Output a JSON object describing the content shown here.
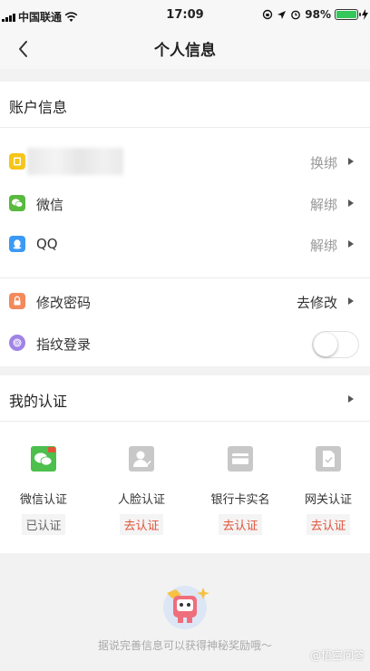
{
  "status_bar": {
    "carrier": "中国联通",
    "time": "17:09",
    "battery_pct": "98%",
    "battery_level": 0.98,
    "icons": [
      "signal-bars-icon",
      "wifi-icon",
      "rotation-lock-icon",
      "location-icon",
      "alarm-icon",
      "battery-icon",
      "charging-icon"
    ]
  },
  "nav": {
    "title": "个人信息",
    "back_icon": "chevron-left-icon"
  },
  "account": {
    "title": "账户信息",
    "rows": [
      {
        "label": "",
        "action": "换绑",
        "icon": "phone-card-icon",
        "icon_color": "#f5c518",
        "blurred": true
      },
      {
        "label": "微信",
        "action": "解绑",
        "icon": "wechat-icon",
        "icon_color": "#5ab93f"
      },
      {
        "label": "QQ",
        "action": "解绑",
        "icon": "qq-icon",
        "icon_color": "#3b9af5"
      }
    ],
    "security": [
      {
        "label": "修改密码",
        "action": "去修改",
        "icon": "lock-icon",
        "icon_color": "#f28a5c"
      },
      {
        "label": "指纹登录",
        "icon": "fingerprint-icon",
        "icon_color": "#a083e6",
        "toggle_on": false
      }
    ]
  },
  "certification": {
    "title": "我的认证",
    "items": [
      {
        "label": "微信认证",
        "status": "已认证",
        "icon": "wechat-cert-icon",
        "status_color": "#666666",
        "icon_color": "#4cbf4c"
      },
      {
        "label": "人脸认证",
        "status": "去认证",
        "icon": "face-cert-icon",
        "status_color": "#e2533a",
        "icon_color": "#c8c8c8"
      },
      {
        "label": "银行卡实名",
        "status": "去认证",
        "icon": "bank-card-icon",
        "status_color": "#e2533a",
        "icon_color": "#c8c8c8"
      },
      {
        "label": "网关认证",
        "status": "去认证",
        "icon": "sim-card-icon",
        "status_color": "#e2533a",
        "icon_color": "#c8c8c8"
      }
    ]
  },
  "footer": {
    "text": "据说完善信息可以获得神秘奖励哦～",
    "mascot_icon": "robot-mascot-icon",
    "watermark": "@悟空问答"
  }
}
